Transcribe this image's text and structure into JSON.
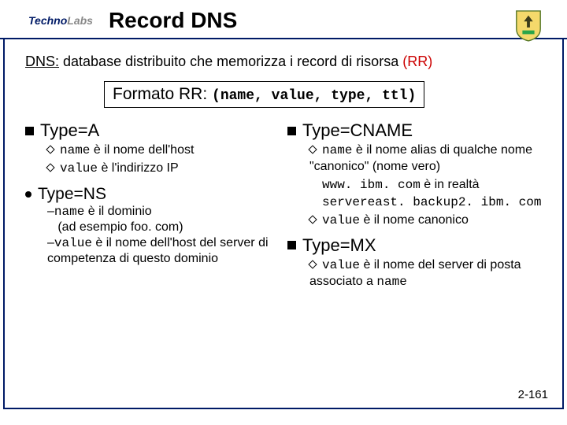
{
  "header": {
    "logo_dark": "Techno",
    "logo_gray": "Labs",
    "title": "Record DNS"
  },
  "intro": {
    "dns_label": "DNS:",
    "text": " database distribuito che memorizza i record di risorsa ",
    "rr": "(RR)"
  },
  "format": {
    "label": "Formato RR: ",
    "tuple": "(name, value, type, ttl)"
  },
  "left": {
    "typeA": {
      "heading": "Type=A",
      "l1a": "name",
      "l1b": " è il nome dell'host",
      "l2a": "value",
      "l2b": " è l'indirizzo IP"
    },
    "typeNS": {
      "heading": "Type=NS",
      "l1a": "name",
      "l1b": " è il dominio",
      "l1c": "(ad esempio foo. com)",
      "l2a": "value",
      "l2b": " è il nome dell'host del server di competenza di questo dominio"
    }
  },
  "right": {
    "typeCNAME": {
      "heading": "Type=CNAME",
      "l1a": "name",
      "l1b": " è il nome alias di qualche nome \"canonico\" (nome vero)",
      "l1c": "www. ibm. com",
      "l1d": " è in realtà",
      "l1e": "servereast. backup2. ibm. com",
      "l2a": "value",
      "l2b": " è il nome canonico"
    },
    "typeMX": {
      "heading": "Type=MX",
      "l1a": "value",
      "l1b": " è il nome del server di posta associato a ",
      "l1c": "name"
    }
  },
  "pagenum": "2-161"
}
